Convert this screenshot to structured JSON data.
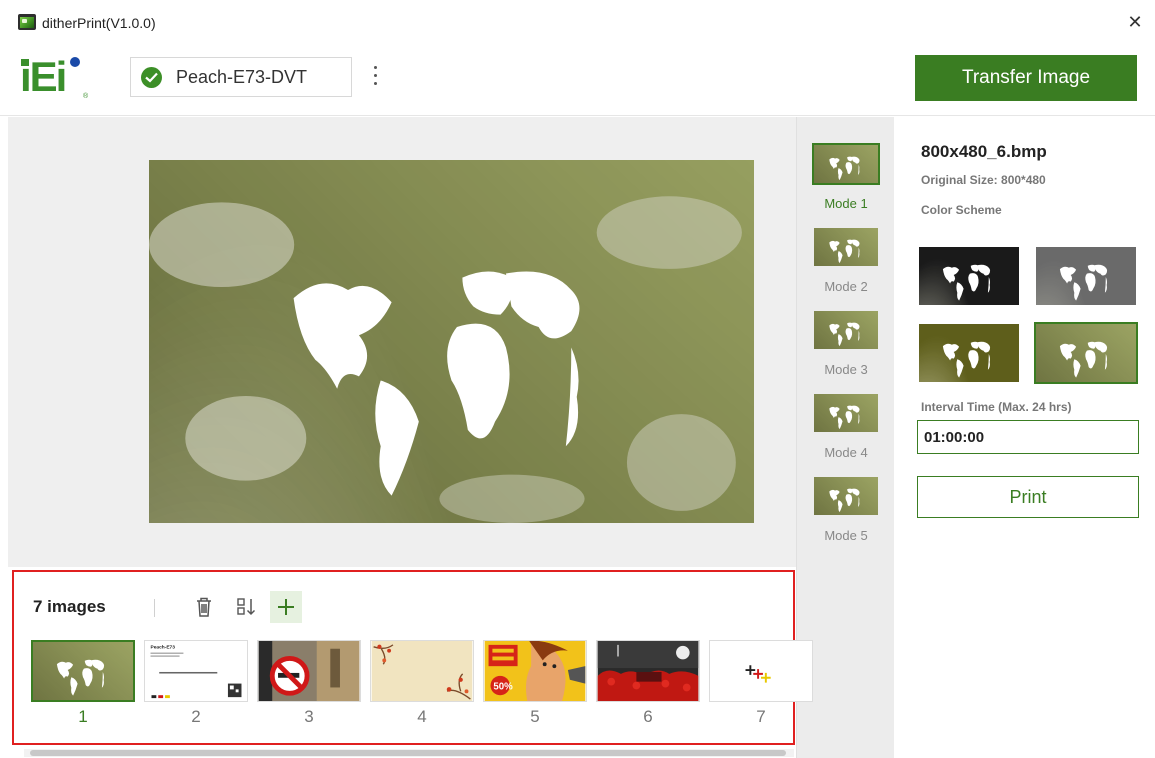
{
  "window": {
    "title": "ditherPrint(V1.0.0)",
    "close_glyph": "✕"
  },
  "header": {
    "logo_text": "iEi",
    "device_name": "Peach-E73-DVT",
    "transfer_label": "Transfer Image"
  },
  "modes": [
    {
      "label": "Mode 1",
      "active": true
    },
    {
      "label": "Mode 2",
      "active": false
    },
    {
      "label": "Mode 3",
      "active": false
    },
    {
      "label": "Mode 4",
      "active": false
    },
    {
      "label": "Mode 5",
      "active": false
    }
  ],
  "details": {
    "file_name": "800x480_6.bmp",
    "original_size": "Original Size: 800*480",
    "color_scheme_label": "Color Scheme",
    "interval_label": "Interval Time (Max. 24 hrs)",
    "interval_value": "01:00:00",
    "print_label": "Print"
  },
  "images": {
    "count_label": "7 images",
    "items": [
      {
        "number": "1",
        "active": true
      },
      {
        "number": "2",
        "active": false,
        "caption": "Peach-E73"
      },
      {
        "number": "3",
        "active": false
      },
      {
        "number": "4",
        "active": false
      },
      {
        "number": "5",
        "active": false,
        "caption": "50%"
      },
      {
        "number": "6",
        "active": false
      },
      {
        "number": "7",
        "active": false
      }
    ]
  },
  "colors": {
    "accent": "#3a7d22",
    "highlight": "#e02020"
  }
}
